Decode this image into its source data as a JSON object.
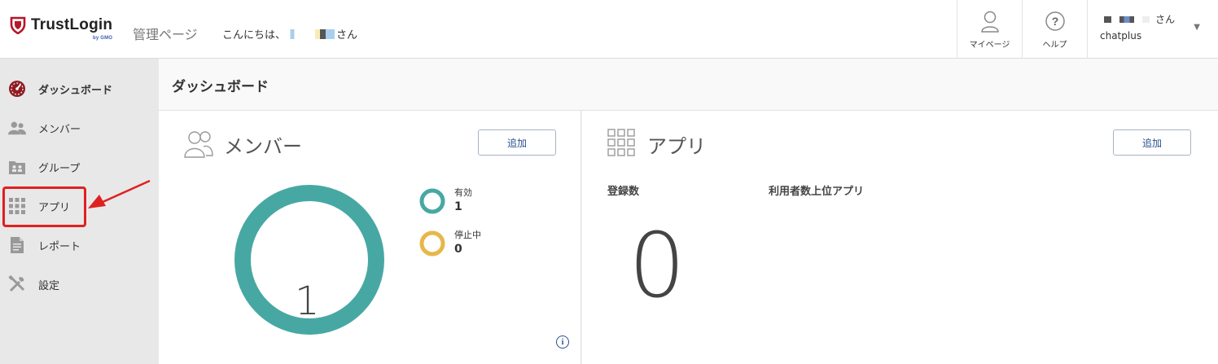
{
  "header": {
    "brand": "TrustLogin",
    "brand_sub": "by GMO",
    "admin_label": "管理ページ",
    "greeting_prefix": "こんにちは、",
    "greeting_suffix": "さん",
    "mypage_label": "マイページ",
    "help_label": "ヘルプ",
    "user_suffix": "さん",
    "user_org": "chatplus"
  },
  "sidebar": {
    "items": [
      {
        "label": "ダッシュボード",
        "icon": "dashboard-icon"
      },
      {
        "label": "メンバー",
        "icon": "members-icon"
      },
      {
        "label": "グループ",
        "icon": "group-icon"
      },
      {
        "label": "アプリ",
        "icon": "apps-grid-icon"
      },
      {
        "label": "レポート",
        "icon": "report-icon"
      },
      {
        "label": "設定",
        "icon": "settings-tools-icon"
      }
    ]
  },
  "main": {
    "page_title": "ダッシュボード",
    "members": {
      "title": "メンバー",
      "add_label": "追加",
      "total": "1",
      "legend": [
        {
          "label": "有効",
          "value": "1",
          "color": "#47a8a3"
        },
        {
          "label": "停止中",
          "value": "0",
          "color": "#e6b84a"
        }
      ]
    },
    "apps": {
      "title": "アプリ",
      "add_label": "追加",
      "registered_label": "登録数",
      "top_label": "利用者数上位アプリ",
      "registered_count": "0"
    }
  },
  "colors": {
    "brand_red": "#b5172b",
    "accent_teal": "#47a8a3",
    "accent_yellow": "#e6b84a",
    "annotation_red": "#e02020"
  }
}
